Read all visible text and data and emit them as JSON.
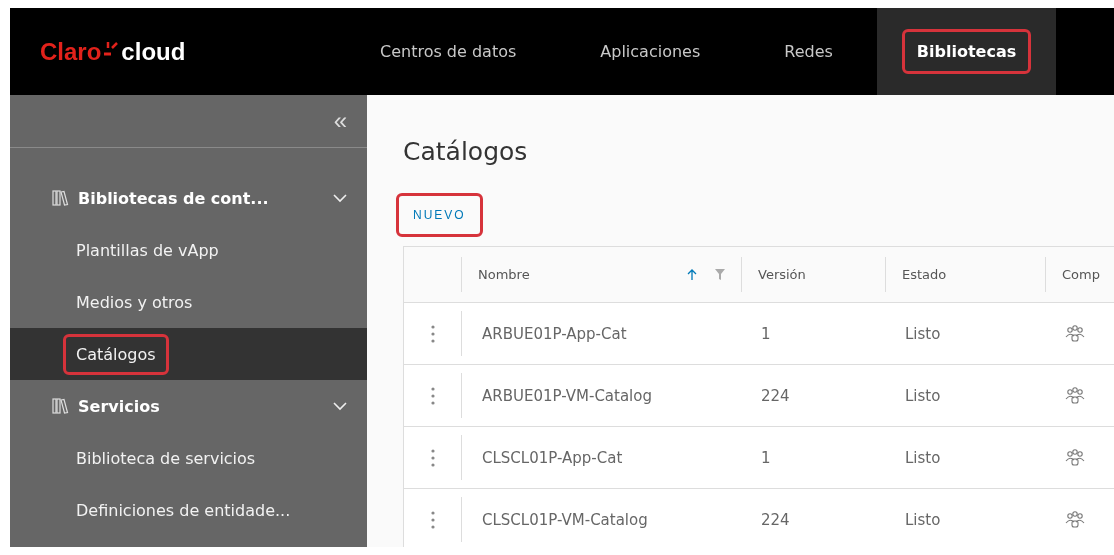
{
  "header": {
    "logo": {
      "brand": "Claro",
      "product": "cloud"
    },
    "nav": [
      {
        "label": "Centros de datos",
        "selected": false,
        "highlighted": false
      },
      {
        "label": "Aplicaciones",
        "selected": false,
        "highlighted": false
      },
      {
        "label": "Redes",
        "selected": false,
        "highlighted": false
      },
      {
        "label": "Bibliotecas",
        "selected": true,
        "highlighted": true
      }
    ]
  },
  "sidebar": {
    "collapse": "«",
    "groups": [
      {
        "label": "Bibliotecas de cont...",
        "expanded": true,
        "children": [
          {
            "label": "Plantillas de vApp",
            "selected": false,
            "highlighted": false
          },
          {
            "label": "Medios y otros",
            "selected": false,
            "highlighted": false
          },
          {
            "label": "Catálogos",
            "selected": true,
            "highlighted": true
          }
        ]
      },
      {
        "label": "Servicios",
        "expanded": true,
        "children": [
          {
            "label": "Biblioteca de servicios",
            "selected": false,
            "highlighted": false
          },
          {
            "label": "Definiciones de entidade...",
            "selected": false,
            "highlighted": false
          }
        ]
      }
    ]
  },
  "page": {
    "title": "Catálogos",
    "new_button": {
      "label": "NUEVO",
      "highlighted": true
    }
  },
  "table": {
    "columns": [
      {
        "label": "Nombre",
        "sort_ascending": true,
        "filterable": true
      },
      {
        "label": "Versión",
        "sort_ascending": false,
        "filterable": false
      },
      {
        "label": "Estado",
        "sort_ascending": false,
        "filterable": false
      },
      {
        "label": "Comp",
        "sort_ascending": false,
        "filterable": false
      }
    ],
    "rows": [
      {
        "name": "ARBUE01P-App-Cat",
        "version": "1",
        "status": "Listo",
        "shared": true
      },
      {
        "name": "ARBUE01P-VM-Catalog",
        "version": "224",
        "status": "Listo",
        "shared": true
      },
      {
        "name": "CLSCL01P-App-Cat",
        "version": "1",
        "status": "Listo",
        "shared": true
      },
      {
        "name": "CLSCL01P-VM-Catalog",
        "version": "224",
        "status": "Listo",
        "shared": true
      }
    ]
  }
}
